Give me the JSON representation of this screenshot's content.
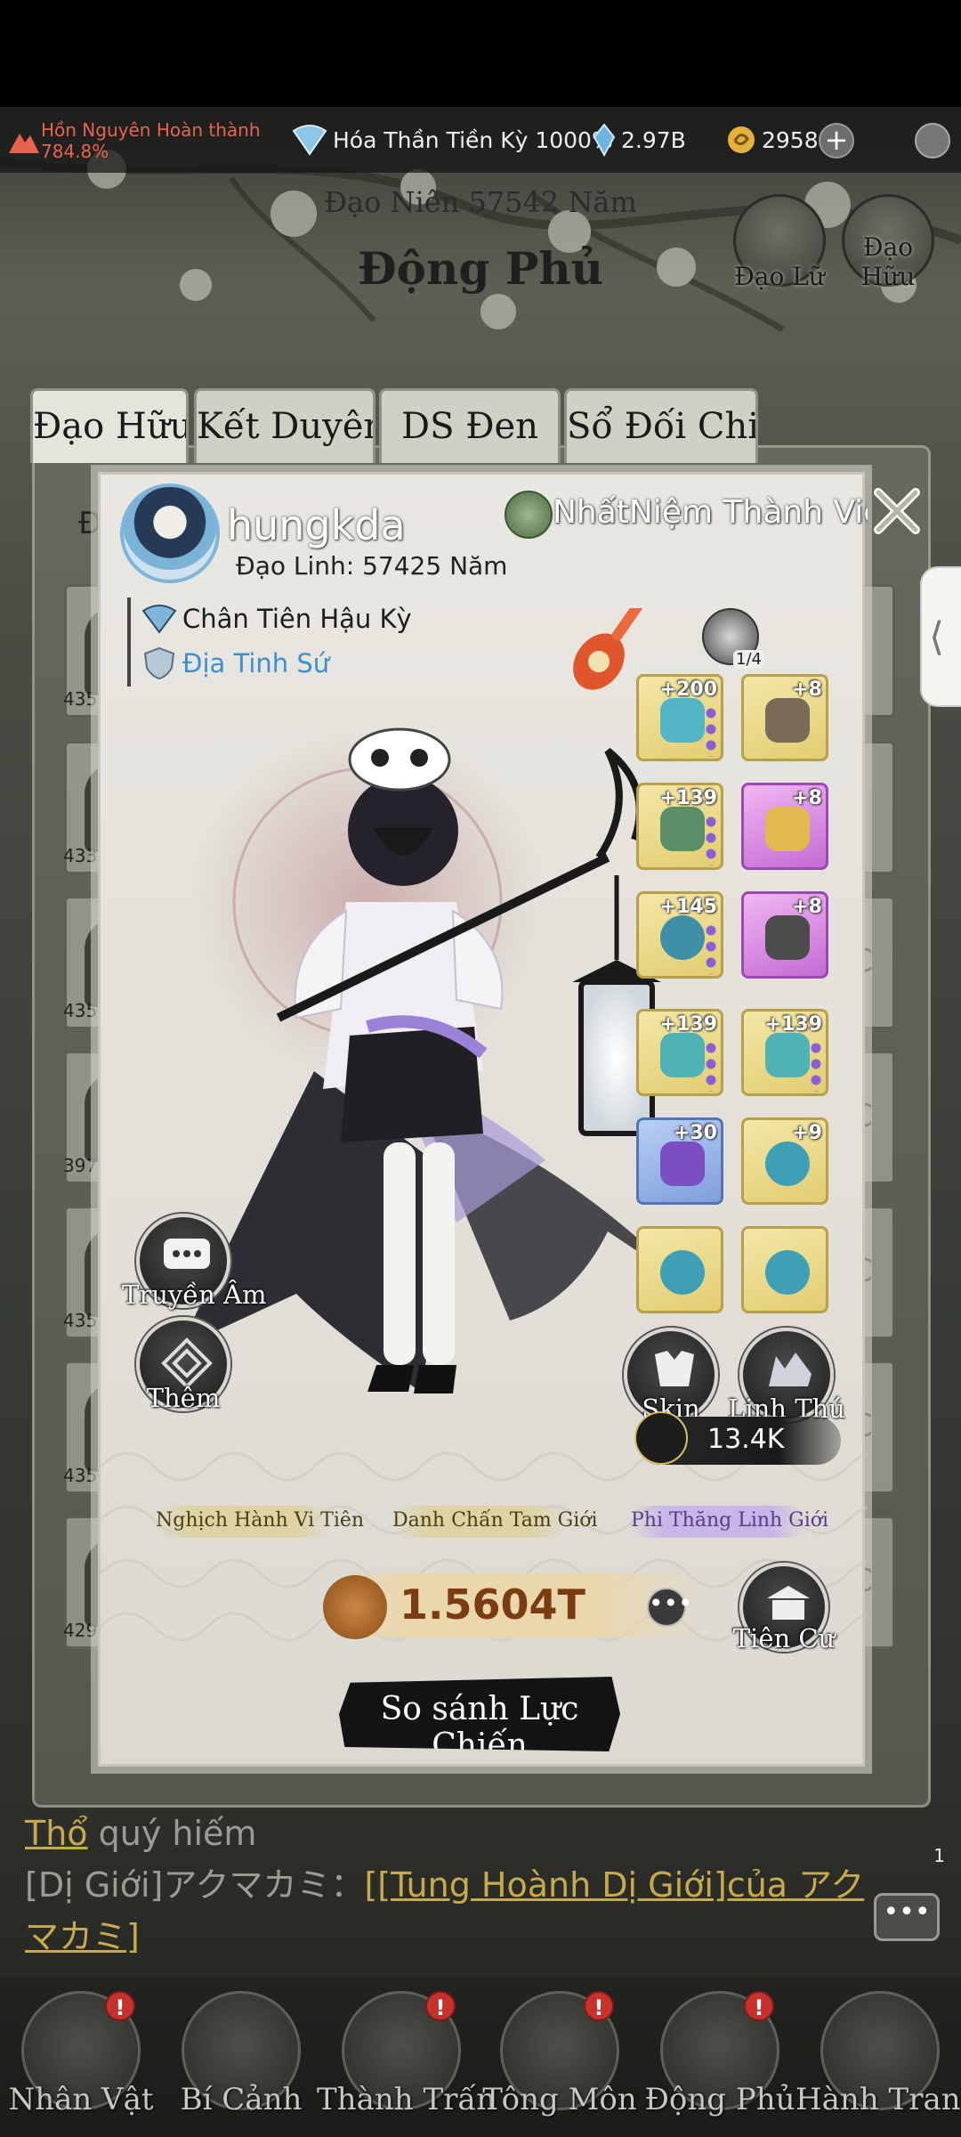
{
  "statusbar": {
    "quest_line1": "Hồn Nguyên Hoàn thành",
    "quest_line2": "784.8%",
    "realm_progress": "Hóa Thần Tiền Kỳ 1000%",
    "spirit_stone": "2.97B",
    "coin": "2958",
    "plus_label": "+"
  },
  "cave": {
    "years": "Đạo Niên 57542 Năm",
    "title": "Động Phủ",
    "partner_label": "Đạo Lữ",
    "friend_label": "Đạo Hữu"
  },
  "tabs": [
    "Đạo Hữu",
    "Kết Duyên",
    "DS Đen",
    "Sổ Đối Chiến"
  ],
  "bg_rows": [
    {
      "num": "435-",
      "tail": ""
    },
    {
      "num": "433-",
      "tail": ""
    },
    {
      "num": "435-",
      "tail": "C"
    },
    {
      "num": "397-",
      "tail": "C"
    },
    {
      "num": "435-",
      "tail": "C"
    },
    {
      "num": "435-",
      "tail": "C"
    },
    {
      "num": "429-",
      "tail": "C"
    }
  ],
  "bg_header_partial": "Đ",
  "side_handle": "⟨",
  "profile": {
    "username": "hungkda",
    "dao_linh": "Đạo Linh: 57425 Năm",
    "sect": "NhấtNiệm  Thành Viên",
    "cultivation_realm": "Chân Tiên Hậu Kỳ",
    "rank": "Địa Tinh Sứ",
    "pet_count": "1/4",
    "equipment": [
      {
        "level": "+200",
        "rarity": "gold"
      },
      {
        "level": "+8",
        "rarity": "gold"
      },
      {
        "level": "+139",
        "rarity": "gold"
      },
      {
        "level": "+8",
        "rarity": "purple"
      },
      {
        "level": "+145",
        "rarity": "gold"
      },
      {
        "level": "+8",
        "rarity": "purple"
      },
      {
        "level": "+139",
        "rarity": "gold"
      },
      {
        "level": "+139",
        "rarity": "gold"
      },
      {
        "level": "+30",
        "rarity": "blue"
      },
      {
        "level": "+9",
        "rarity": "gold"
      },
      {
        "level": "",
        "rarity": "gold"
      },
      {
        "level": "",
        "rarity": "gold"
      }
    ],
    "buttons": {
      "whisper": "Truyền Âm",
      "more": "Thêm",
      "skin": "Skin",
      "spirit_beast": "Linh Thú",
      "residence": "Tiên Cư",
      "compare": "So sánh Lực Chiến",
      "ellipsis": "•••"
    },
    "rune_value": "13.4K",
    "titles": [
      "Nghịch Hành Vi Tiên",
      "Danh Chấn Tam Giới",
      "Phi Thăng Linh Giới"
    ],
    "combat_power": "1.5604T"
  },
  "chat": {
    "line1_prefix": "Thổ",
    "line1_rest": " quý hiếm",
    "line2_prefix": "[Dị Giới]アクマカミ：",
    "line2_link": "[[Tung Hoành Dị Giới]của アクマカミ]",
    "button": "•••",
    "badge": "1"
  },
  "nav": [
    {
      "label": "Nhân Vật",
      "alert": "!"
    },
    {
      "label": "Bí Cảnh",
      "alert": ""
    },
    {
      "label": "Thành Trấn",
      "alert": "!"
    },
    {
      "label": "Tông Môn",
      "alert": "!"
    },
    {
      "label": "Động Phủ",
      "alert": "!"
    },
    {
      "label": "Hành Trang",
      "alert": ""
    }
  ],
  "colors": {
    "quest_red": "#e8634e",
    "rank_blue": "#3f8fcf",
    "power_brown": "#7b3c12",
    "alert_red": "#c7312c"
  }
}
